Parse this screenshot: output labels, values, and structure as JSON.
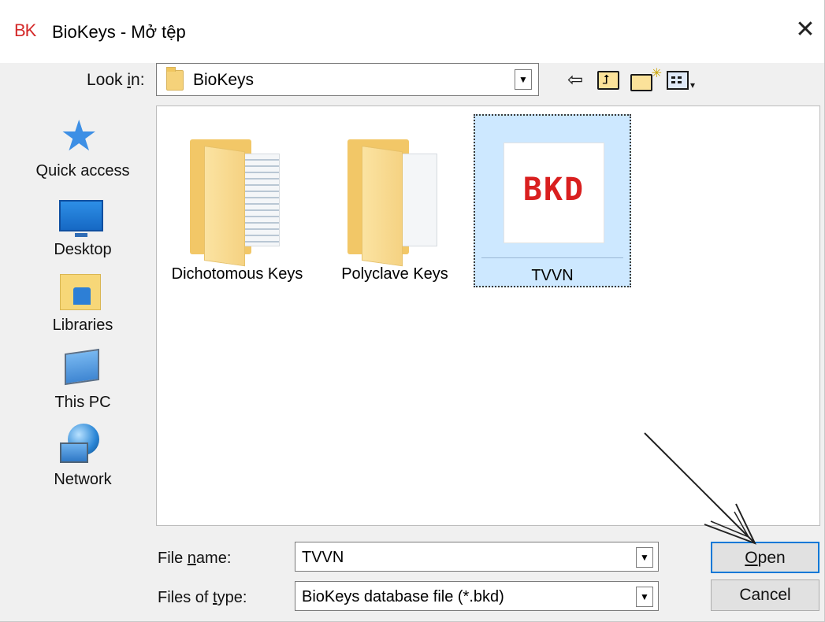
{
  "window": {
    "app_logo": "BK",
    "title": "BioKeys - Mở tệp",
    "close_glyph": "✕"
  },
  "look_in": {
    "label_prefix": "Look ",
    "label_accel": "i",
    "label_suffix": "n:",
    "value": "BioKeys",
    "dropdown_glyph": "▼"
  },
  "toolbar": {
    "back_glyph": "⇦",
    "view_caret": "▾"
  },
  "places": [
    {
      "label": "Quick access",
      "icon": "star-icon"
    },
    {
      "label": "Desktop",
      "icon": "desktop-icon"
    },
    {
      "label": "Libraries",
      "icon": "libraries-icon"
    },
    {
      "label": "This PC",
      "icon": "computer-icon"
    },
    {
      "label": "Network",
      "icon": "network-icon"
    }
  ],
  "files": [
    {
      "name": "Dichotomous Keys",
      "type": "folder"
    },
    {
      "name": "Polyclave Keys",
      "type": "folder"
    },
    {
      "name": "TVVN",
      "type": "bkd-file",
      "thumbnail_text": "BKD",
      "selected": true
    }
  ],
  "file_name": {
    "label_prefix": "File ",
    "label_accel": "n",
    "label_suffix": "ame:",
    "value": "TVVN",
    "dropdown_glyph": "▼"
  },
  "file_type": {
    "label_prefix": "Files of ",
    "label_accel": "t",
    "label_suffix": "ype:",
    "value": "BioKeys database file (*.bkd)",
    "dropdown_glyph": "▼"
  },
  "buttons": {
    "open_accel": "O",
    "open_rest": "pen",
    "cancel": "Cancel"
  },
  "colors": {
    "selection": "#cde8ff",
    "logo_red": "#d42a2a",
    "accent": "#0078d7"
  }
}
